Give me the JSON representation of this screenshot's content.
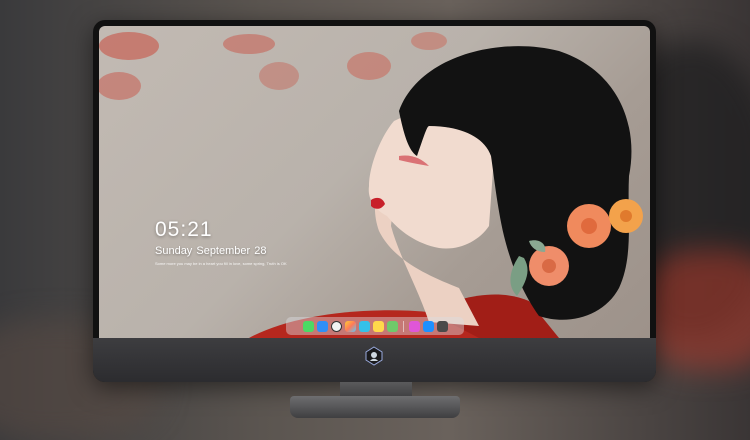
{
  "lockscreen": {
    "time": "05:21",
    "date": "Sunday September  28",
    "quote": "Some more you may be in a heart you fill in love, some spring, Truth is OK"
  },
  "dock": {
    "icons": [
      {
        "name": "messages-icon",
        "color": "#4cd964"
      },
      {
        "name": "finder-icon",
        "color": "#2f8ff7"
      },
      {
        "name": "clock-icon",
        "color": "#f2f2f2"
      },
      {
        "name": "photos-icon",
        "color": "#ffcc33"
      },
      {
        "name": "video-clapper-icon",
        "color": "#35c0e8"
      },
      {
        "name": "notes-icon",
        "color": "#ffd84a"
      },
      {
        "name": "calendar-icon",
        "color": "#6fc96a"
      },
      {
        "name": "music-icon",
        "color": "#e056d8"
      },
      {
        "name": "app-store-icon",
        "color": "#1e90ff"
      },
      {
        "name": "camera-icon",
        "color": "#4a4a4a"
      }
    ]
  },
  "colors": {
    "accent_red": "#c0392b",
    "hair": "#121212",
    "flower": "#f08a5d"
  }
}
